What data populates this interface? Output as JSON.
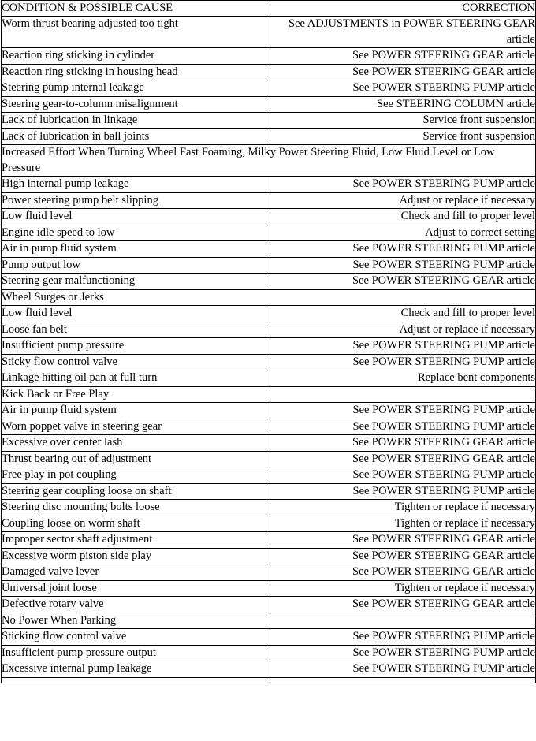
{
  "table": {
    "headers": {
      "condition": "CONDITION & POSSIBLE CAUSE",
      "correction": "CORRECTION"
    },
    "rows": [
      {
        "type": "data",
        "condition": "Worm thrust bearing adjusted too tight",
        "correction": "See ADJUSTMENTS in POWER STEERING GEAR article"
      },
      {
        "type": "data",
        "condition": "Reaction ring sticking in cylinder",
        "correction": "See POWER STEERING GEAR article"
      },
      {
        "type": "data",
        "condition": "Reaction ring sticking in housing head",
        "correction": "See POWER STEERING GEAR article"
      },
      {
        "type": "data",
        "condition": "Steering pump internal leakage",
        "correction": "See POWER STEERING PUMP article"
      },
      {
        "type": "data",
        "condition": "Steering gear-to-column misalignment",
        "correction": "See STEERING COLUMN article"
      },
      {
        "type": "data",
        "condition": "Lack of lubrication in linkage",
        "correction": "Service front suspension"
      },
      {
        "type": "data",
        "condition": "Lack of lubrication in ball joints",
        "correction": "Service front suspension"
      },
      {
        "type": "section",
        "title": "Increased Effort When Turning Wheel Fast Foaming, Milky Power Steering Fluid, Low Fluid Level or Low Pressure"
      },
      {
        "type": "data",
        "condition": "High internal pump leakage",
        "correction": "See POWER STEERING PUMP article"
      },
      {
        "type": "data",
        "condition": "Power steering pump belt slipping",
        "correction": "Adjust or replace if necessary"
      },
      {
        "type": "data",
        "condition": "Low fluid level",
        "correction": "Check and fill to proper level"
      },
      {
        "type": "data",
        "condition": "Engine idle speed to low",
        "correction": "Adjust to correct setting"
      },
      {
        "type": "data",
        "condition": "Air in pump fluid system",
        "correction": "See POWER STEERING PUMP article"
      },
      {
        "type": "data",
        "condition": "Pump output low",
        "correction": "See POWER STEERING PUMP article"
      },
      {
        "type": "data",
        "condition": "Steering gear malfunctioning",
        "correction": "See POWER STEERING GEAR article"
      },
      {
        "type": "section",
        "title": "Wheel Surges or Jerks"
      },
      {
        "type": "data",
        "condition": "Low fluid level",
        "correction": "Check and fill to proper level"
      },
      {
        "type": "data",
        "condition": "Loose fan belt",
        "correction": "Adjust or replace if necessary"
      },
      {
        "type": "data",
        "condition": "Insufficient pump pressure",
        "correction": "See POWER STEERING PUMP article"
      },
      {
        "type": "data",
        "condition": "Sticky flow control valve",
        "correction": "See POWER STEERING PUMP article"
      },
      {
        "type": "data",
        "condition": "Linkage hitting oil pan at full turn",
        "correction": "Replace bent components"
      },
      {
        "type": "section",
        "title": "Kick Back or Free Play"
      },
      {
        "type": "data",
        "condition": "Air in pump fluid system",
        "correction": "See POWER STEERING PUMP article"
      },
      {
        "type": "data",
        "condition": "Worn poppet valve in steering gear",
        "correction": "See POWER STEERING PUMP article"
      },
      {
        "type": "data",
        "condition": "Excessive over center lash",
        "correction": "See POWER STEERING GEAR article"
      },
      {
        "type": "data",
        "condition": "Thrust bearing out of adjustment",
        "correction": "See POWER STEERING GEAR article"
      },
      {
        "type": "data",
        "condition": "Free play in pot coupling",
        "correction": "See POWER STEERING PUMP article"
      },
      {
        "type": "data",
        "condition": "Steering gear coupling loose on shaft",
        "correction": "See POWER STEERING PUMP article"
      },
      {
        "type": "data",
        "condition": "Steering disc mounting bolts loose",
        "correction": "Tighten or replace if necessary"
      },
      {
        "type": "data",
        "condition": "Coupling loose on worm shaft",
        "correction": "Tighten or replace if necessary"
      },
      {
        "type": "data",
        "condition": "Improper sector shaft adjustment",
        "correction": "See POWER STEERING GEAR article"
      },
      {
        "type": "data",
        "condition": "Excessive worm piston side play",
        "correction": "See POWER STEERING GEAR article"
      },
      {
        "type": "data",
        "condition": "Damaged valve lever",
        "correction": "See POWER STEERING GEAR article"
      },
      {
        "type": "data",
        "condition": "Universal joint loose",
        "correction": "Tighten or replace if necessary"
      },
      {
        "type": "data",
        "condition": "Defective rotary valve",
        "correction": "See POWER STEERING GEAR article"
      },
      {
        "type": "section",
        "title": "No Power When Parking"
      },
      {
        "type": "data",
        "condition": "Sticking flow control valve",
        "correction": "See POWER STEERING PUMP article"
      },
      {
        "type": "data",
        "condition": "Insufficient pump pressure output",
        "correction": "See POWER STEERING PUMP article"
      },
      {
        "type": "data",
        "condition": "Excessive internal pump leakage",
        "correction": "See POWER STEERING PUMP article"
      },
      {
        "type": "partial",
        "condition": "",
        "correction": ""
      }
    ]
  },
  "colors": {
    "border": "#000000",
    "text": "#000000",
    "background": "#ffffff"
  }
}
